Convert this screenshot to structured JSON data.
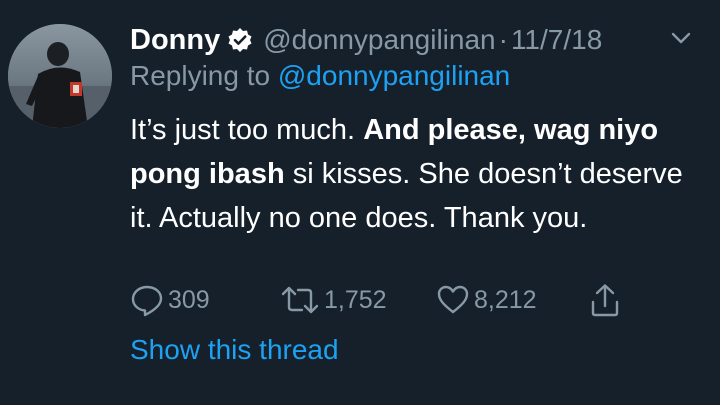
{
  "tweet": {
    "display_name": "Donny",
    "handle": "@donnypangilinan",
    "separator": "·",
    "date": "11/7/18",
    "replying_prefix": "Replying to",
    "replying_to": "@donnypangilinan",
    "body_parts": [
      {
        "text": "It’s just too much. ",
        "bold": false
      },
      {
        "text": "And please, wag niyo pong ibash",
        "bold": true
      },
      {
        "text": " si kisses. She doesn’t deserve it. Actually no one does. Thank you.",
        "bold": false
      }
    ],
    "replies": "309",
    "retweets": "1,752",
    "likes": "8,212",
    "show_thread": "Show this thread"
  },
  "colors": {
    "background": "#15202b",
    "text": "#ffffff",
    "muted": "#8899a6",
    "accent": "#1da1f2"
  },
  "icons": {
    "verified": "verified-badge-icon",
    "more": "chevron-down-icon",
    "reply": "reply-icon",
    "retweet": "retweet-icon",
    "like": "heart-icon",
    "share": "share-icon"
  }
}
